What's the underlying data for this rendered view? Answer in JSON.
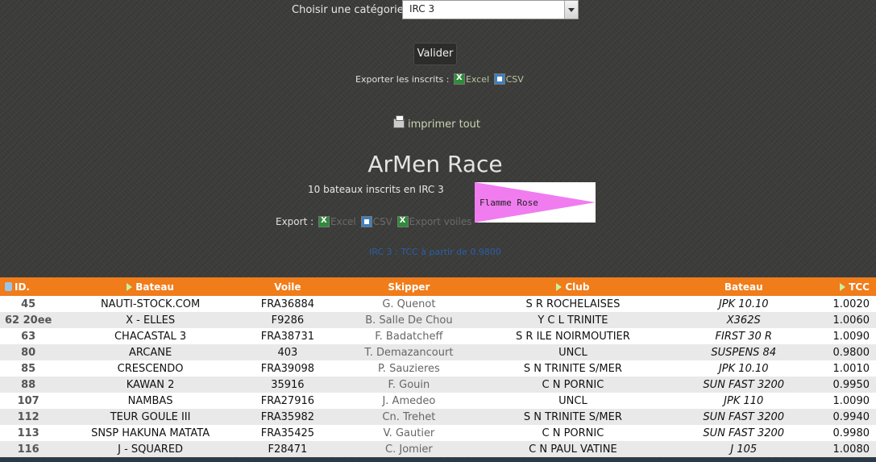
{
  "category": {
    "label": "Choisir une catégorie",
    "selected": "IRC 3"
  },
  "validate_label": "Valider",
  "export_inscrits": {
    "label": "Exporter les inscrits :",
    "excel": "Excel",
    "csv": "CSV"
  },
  "print_label": "imprimer tout",
  "race_title": "ArMen Race",
  "count_text": "10 bateaux inscrits en IRC 3",
  "flag_label": "Flamme Rose",
  "flag_color": "#f07cf0",
  "export2": {
    "label": "Export :",
    "excel": "Excel",
    "csv": "CSV",
    "sails": "Export voiles"
  },
  "irc_note": "IRC 3 : TCC à partir de 0.9800",
  "table": {
    "headers": [
      "ID.",
      "Bateau",
      "Voile",
      "Skipper",
      "Club",
      "Bateau",
      "TCC"
    ],
    "rows": [
      {
        "id": "45",
        "bateau": "NAUTI-STOCK.COM",
        "voile": "FRA36884",
        "skipper": "G. Quenot",
        "club": "S R ROCHELAISES",
        "modele": "JPK 10.10",
        "tcc": "1.0020"
      },
      {
        "id": "62 20ee",
        "bateau": "X - ELLES",
        "voile": "F9286",
        "skipper": "B. Salle De Chou",
        "club": "Y C L TRINITE",
        "modele": "X362S",
        "tcc": "1.0060"
      },
      {
        "id": "63",
        "bateau": "CHACASTAL 3",
        "voile": "FRA38731",
        "skipper": "F. Badatcheff",
        "club": "S R ILE NOIRMOUTIER",
        "modele": "FIRST 30 R",
        "tcc": "1.0090"
      },
      {
        "id": "80",
        "bateau": "ARCANE",
        "voile": "403",
        "skipper": "T. Demazancourt",
        "club": "UNCL",
        "modele": "SUSPENS 84",
        "tcc": "0.9800"
      },
      {
        "id": "85",
        "bateau": "CRESCENDO",
        "voile": "FRA39098",
        "skipper": "P. Sauzieres",
        "club": "S N TRINITE S/MER",
        "modele": "JPK 10.10",
        "tcc": "1.0010"
      },
      {
        "id": "88",
        "bateau": "KAWAN 2",
        "voile": "35916",
        "skipper": "F. Gouin",
        "club": "C N PORNIC",
        "modele": "SUN FAST 3200",
        "tcc": "0.9950"
      },
      {
        "id": "107",
        "bateau": "NAMBAS",
        "voile": "FRA27916",
        "skipper": "J. Amedeo",
        "club": "UNCL",
        "modele": "JPK 110",
        "tcc": "1.0090"
      },
      {
        "id": "112",
        "bateau": "TEUR GOULE III",
        "voile": "FRA35982",
        "skipper": "Cn. Trehet",
        "club": "S N TRINITE S/MER",
        "modele": "SUN FAST 3200",
        "tcc": "0.9940"
      },
      {
        "id": "113",
        "bateau": "SNSP HAKUNA MATATA",
        "voile": "FRA35425",
        "skipper": "V. Gautier",
        "club": "C N PORNIC",
        "modele": "SUN FAST 3200",
        "tcc": "0.9980"
      },
      {
        "id": "116",
        "bateau": "J - SQUARED",
        "voile": "F28471",
        "skipper": "C. Jomier",
        "club": "C N PAUL VATINE",
        "modele": "J 105",
        "tcc": "1.0080"
      }
    ]
  }
}
